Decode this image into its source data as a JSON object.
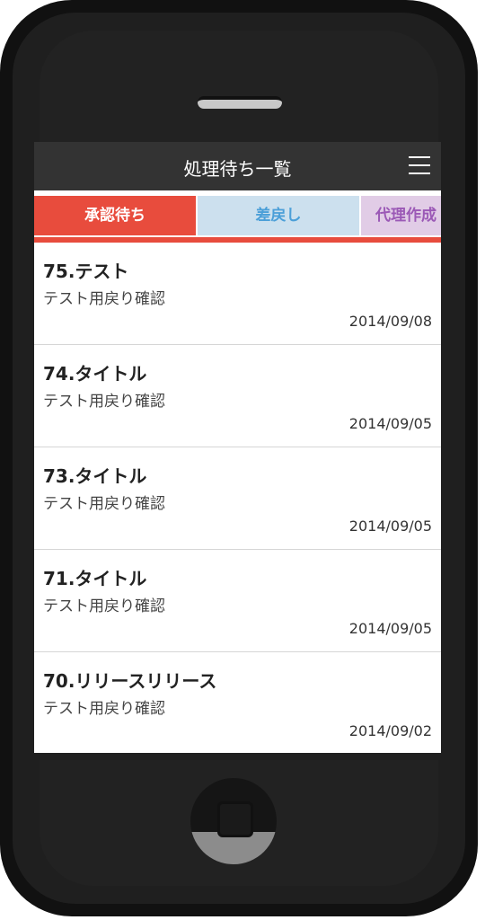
{
  "header": {
    "title": "処理待ち一覧",
    "menu_icon": "hamburger-menu-icon"
  },
  "tabs": [
    {
      "label": "承認待ち",
      "active": true,
      "color": "#e84c3d"
    },
    {
      "label": "差戻し",
      "active": false,
      "color": "#4b9fd8"
    },
    {
      "label": "代理作成",
      "active": false,
      "color": "#9b59b6"
    }
  ],
  "items": [
    {
      "title": "75.テスト",
      "subtitle": "テスト用戻り確認",
      "date": "2014/09/08"
    },
    {
      "title": "74.タイトル",
      "subtitle": "テスト用戻り確認",
      "date": "2014/09/05"
    },
    {
      "title": "73.タイトル",
      "subtitle": "テスト用戻り確認",
      "date": "2014/09/05"
    },
    {
      "title": "71.タイトル",
      "subtitle": "テスト用戻り確認",
      "date": "2014/09/05"
    },
    {
      "title": "70.リリースリリース",
      "subtitle": "テスト用戻り確認",
      "date": "2014/09/02"
    }
  ]
}
